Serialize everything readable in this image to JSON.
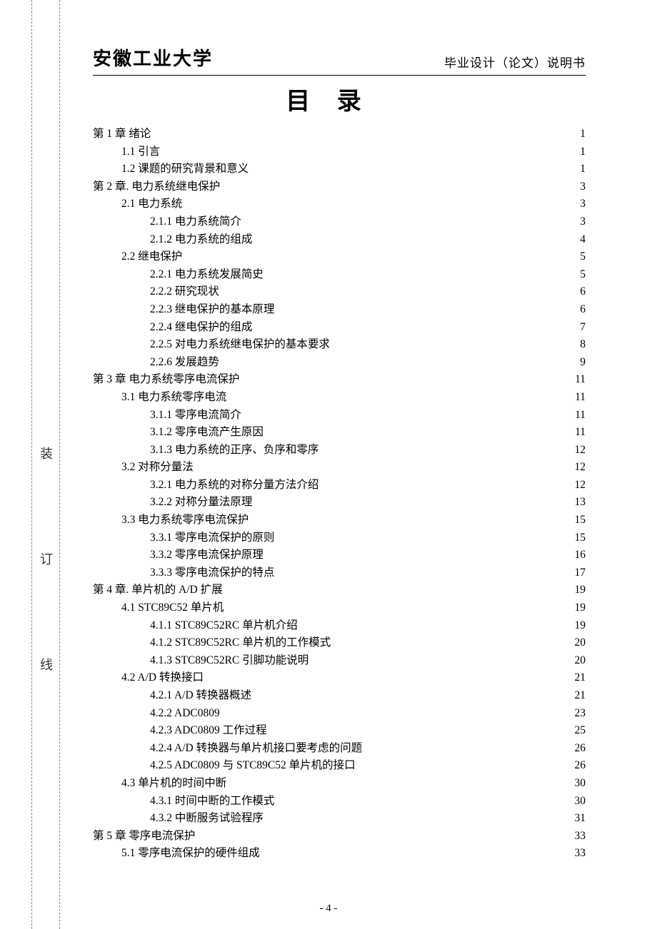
{
  "header": {
    "university": "安徽工业大学",
    "doc_type": "毕业设计（论文）说明书"
  },
  "title": "目 录",
  "side_labels": [
    "装",
    "订",
    "线"
  ],
  "footer": "- 4 -",
  "toc": [
    {
      "level": 1,
      "text": "第 1 章  绪论",
      "page": "1"
    },
    {
      "level": 2,
      "text": "1.1 引言",
      "page": "1"
    },
    {
      "level": 2,
      "text": "1.2 课题的研究背景和意义",
      "page": "1"
    },
    {
      "level": 1,
      "text": "第 2 章. 电力系统继电保护",
      "page": "3"
    },
    {
      "level": 2,
      "text": "2.1 电力系统",
      "page": "3"
    },
    {
      "level": 3,
      "text": "2.1.1 电力系统简介",
      "page": "3"
    },
    {
      "level": 3,
      "text": "2.1.2 电力系统的组成",
      "page": "4"
    },
    {
      "level": 2,
      "text": "2.2 继电保护",
      "page": "5"
    },
    {
      "level": 3,
      "text": "2.2.1 电力系统发展简史",
      "page": "5"
    },
    {
      "level": 3,
      "text": "2.2.2 研究现状",
      "page": "6"
    },
    {
      "level": 3,
      "text": "2.2.3 继电保护的基本原理",
      "page": "6"
    },
    {
      "level": 3,
      "text": "2.2.4 继电保护的组成",
      "page": "7"
    },
    {
      "level": 3,
      "text": "2.2.5 对电力系统继电保护的基本要求",
      "page": "8"
    },
    {
      "level": 3,
      "text": "2.2.6 发展趋势",
      "page": "9"
    },
    {
      "level": 1,
      "text": "第 3 章 电力系统零序电流保护",
      "page": "11"
    },
    {
      "level": 2,
      "text": "3.1 电力系统零序电流",
      "page": "11"
    },
    {
      "level": 3,
      "text": "3.1.1 零序电流简介",
      "page": "11"
    },
    {
      "level": 3,
      "text": "3.1.2 零序电流产生原因",
      "page": "11"
    },
    {
      "level": 3,
      "text": "3.1.3 电力系统的正序、负序和零序",
      "page": "12"
    },
    {
      "level": 2,
      "text": "3.2 对称分量法",
      "page": "12"
    },
    {
      "level": 3,
      "text": "3.2.1 电力系统的对称分量方法介绍",
      "page": "12"
    },
    {
      "level": 3,
      "text": "3.2.2 对称分量法原理",
      "page": "13"
    },
    {
      "level": 2,
      "text": "3.3 电力系统零序电流保护",
      "page": "15"
    },
    {
      "level": 3,
      "text": "3.3.1 零序电流保护的原则",
      "page": "15"
    },
    {
      "level": 3,
      "text": "3.3.2 零序电流保护原理",
      "page": "16"
    },
    {
      "level": 3,
      "text": "3.3.3 零序电流保护的特点",
      "page": "17"
    },
    {
      "level": 1,
      "text": "第 4 章. 单片机的 A/D 扩展",
      "page": "19"
    },
    {
      "level": 2,
      "text": "4.1 STC89C52 单片机",
      "page": "19"
    },
    {
      "level": 3,
      "text": "4.1.1 STC89C52RC 单片机介绍",
      "page": "19"
    },
    {
      "level": 3,
      "text": "4.1.2 STC89C52RC 单片机的工作模式",
      "page": "20"
    },
    {
      "level": 3,
      "text": "4.1.3 STC89C52RC 引脚功能说明",
      "page": "20"
    },
    {
      "level": 2,
      "text": "4.2  A/D 转换接口",
      "page": "21"
    },
    {
      "level": 3,
      "text": "4.2.1 A/D 转换器概述",
      "page": "21"
    },
    {
      "level": 3,
      "text": "4.2.2 ADC0809",
      "page": "23"
    },
    {
      "level": 3,
      "text": "4.2.3 ADC0809 工作过程",
      "page": "25"
    },
    {
      "level": 3,
      "text": "4.2.4 A/D 转换器与单片机接口要考虑的问题",
      "page": "26"
    },
    {
      "level": 3,
      "text": "4.2.5 ADC0809 与 STC89C52 单片机的接口",
      "page": "26"
    },
    {
      "level": 2,
      "text": "4.3 单片机的时间中断",
      "page": "30"
    },
    {
      "level": 3,
      "text": "4.3.1 时间中断的工作模式",
      "page": "30"
    },
    {
      "level": 3,
      "text": "4.3.2 中断服务试验程序",
      "page": "31"
    },
    {
      "level": 1,
      "text": "第 5 章 零序电流保护",
      "page": "33"
    },
    {
      "level": 2,
      "text": "5.1 零序电流保护的硬件组成",
      "page": "33"
    }
  ]
}
